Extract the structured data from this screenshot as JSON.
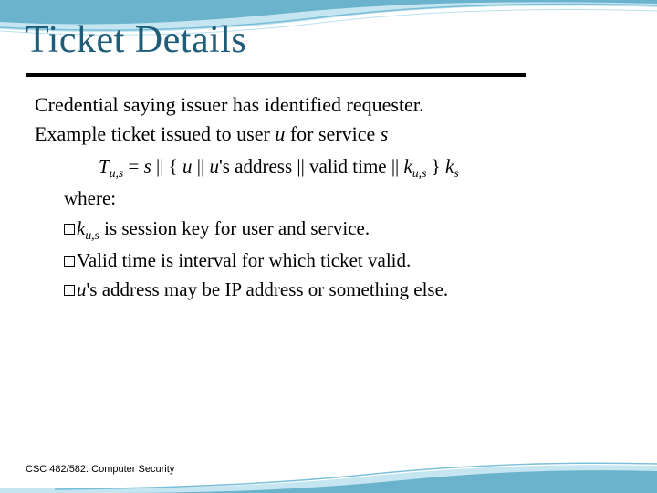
{
  "title": "Ticket Details",
  "lead1": "Credential saying issuer has identified requester.",
  "lead2_pre": "Example ticket issued to user ",
  "lead2_u": "u",
  "lead2_mid": " for service ",
  "lead2_s": "s",
  "formula": {
    "T": "T",
    "sub1": "u,s",
    "eq": " = ",
    "s": "s",
    "bar1": " || { ",
    "u": "u",
    "bar2": " || ",
    "u2": "u",
    "addr": "'s address || valid time || ",
    "k": "k",
    "sub2": "u,s",
    "close": " } ",
    "ks": "k",
    "sub3": "s"
  },
  "where": "where:",
  "b1": {
    "k": "k",
    "sub": "u,s",
    "rest": " is session key for user and service."
  },
  "b2": "Valid time is interval for which ticket valid.",
  "b3": {
    "u": "u",
    "rest": "'s address may be IP address or something else."
  },
  "footer": "CSC 482/582: Computer Security"
}
